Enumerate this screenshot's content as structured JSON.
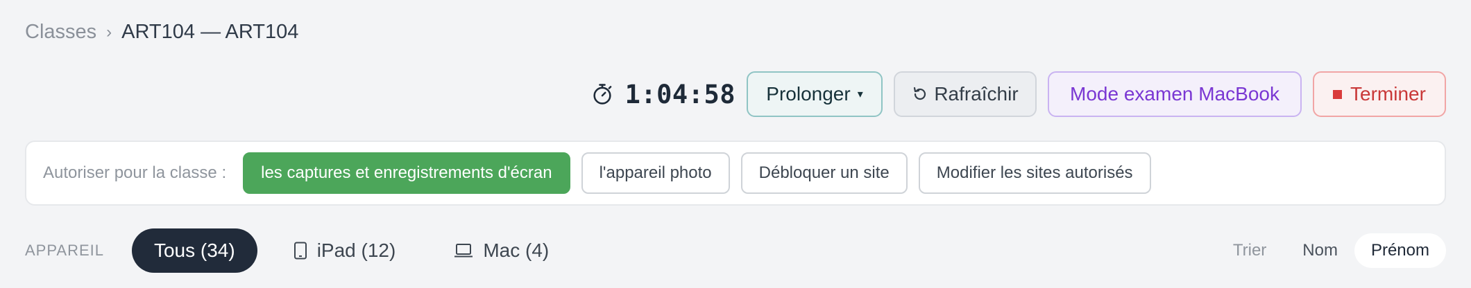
{
  "breadcrumb": {
    "root": "Classes",
    "separator": "›",
    "current": "ART104 — ART104"
  },
  "session": {
    "timer_icon": "stopwatch-icon",
    "timer": "1:04:58",
    "extend_label": "Prolonger",
    "extend_caret": "▾",
    "refresh_icon": "refresh-icon",
    "refresh_label": "Rafraîchir",
    "exam_mode_label": "Mode examen MacBook",
    "stop_icon": "stop-square-icon",
    "stop_label": "Terminer"
  },
  "permissions": {
    "label": "Autoriser pour la classe :",
    "chips": [
      {
        "label": "les captures et enregistrements d'écran",
        "active": true
      },
      {
        "label": "l'appareil photo",
        "active": false
      },
      {
        "label": "Débloquer un site",
        "active": false
      },
      {
        "label": "Modifier les sites autorisés",
        "active": false
      }
    ]
  },
  "devices": {
    "label": "APPAREIL",
    "filters": [
      {
        "label": "Tous (34)",
        "active": true
      },
      {
        "label": "iPad (12)",
        "icon": "tablet-icon",
        "active": false
      },
      {
        "label": "Mac (4)",
        "icon": "laptop-icon",
        "active": false
      }
    ]
  },
  "sort": {
    "label": "Trier",
    "options": [
      {
        "label": "Nom",
        "active": false
      },
      {
        "label": "Prénom",
        "active": true
      }
    ]
  },
  "colors": {
    "allowed_green": "#4ca65a",
    "exam_purple": "#7a37d3",
    "stop_red": "#c93838",
    "active_segment": "#212b3a"
  }
}
